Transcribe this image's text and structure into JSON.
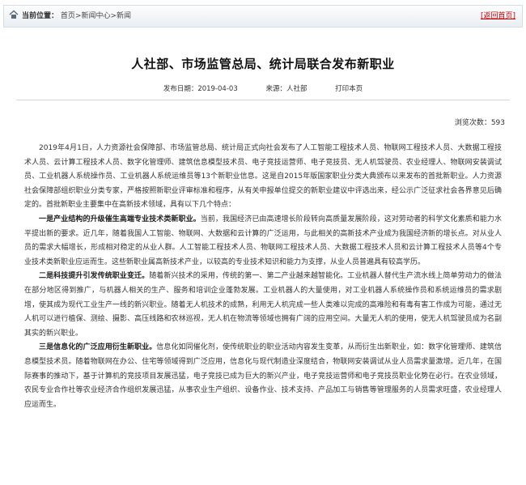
{
  "topbar": {
    "location_label": "当前位置：",
    "crumbs": [
      "首页",
      "新闻中心",
      "新闻"
    ],
    "separator": ">",
    "back_label": "[返回首页]"
  },
  "article": {
    "title": "人社部、市场监管总局、统计局联合发布新职业",
    "date": "发布日期：2019-04-03",
    "source": "来源：人社部",
    "print_label": "打印本页",
    "views": "浏览次数：593",
    "p1": "2019年4月1日，人力资源社会保障部、市场监管总局、统计局正式向社会发布了人工智能工程技术人员、物联网工程技术人员、大数据工程技术人员、云计算工程技术人员、数字化管理师、建筑信息模型技术员、电子竞技运营师、电子竞技员、无人机驾驶员、农业经理人、物联网安装调试员、工业机器人系统操作员、工业机器人系统运维员等13个新职业信息。这是自2015年版国家职业分类大典颁布以来发布的首批新职业。人力资源社会保障部组织职业分类专家，严格按照新职业评审标准和程序，从有关申报单位提交的新职业建议中评选出来，经公示广泛征求社会各界意见后确定的。首批新职业主要集中在高新技术领域，具有以下几个特点：",
    "p2_bold": "一是产业结构的升级催生高端专业技术类新职业。",
    "p2": "当前，我国经济已由高速增长阶段转向高质量发展阶段，这对劳动者的科学文化素质和能力水平提出新的要求。近几年，随着我国人工智能、物联网、大数据和云计算的广泛运用，与此相关的高新技术产业成为我国经济新的增长点。对从业人员的需求大幅增长，形成相对稳定的从业人群。人工智能工程技术人员、物联网工程技术人员、大数据工程技术人员和云计算工程技术人员等4个专业技术类新职业应运而生。这些新职业属高新技术产业，以较高的专业技术知识和能力为支撑，从业人员普遍具有较高学历。",
    "p3_bold": "二是科技提升引发传统职业变迁。",
    "p3": "随着新兴技术的采用，传统的第一、第二产业越来越智能化。工业机器人替代生产流水线上简单劳动力的做法在部分地区得到推广，与机器人相关的生产、服务和培训企业蓬勃发展。工业机器人的大量使用，对工业机器人系统操作员和系统运维员的需求剧增，使其成为现代工业生产一线的新兴职业。随着无人机技术的成熟，利用无人机完成一些人类难以完成的高难险和有毒有害工作成为可能，通过无人机可以进行植保、测绘、摄影、高压线路和农林巡视，无人机在物流等领域也拥有广阔的应用空间。大量无人机的使用，使无人机驾驶员成为名副其实的新兴职业。",
    "p4_bold": "三是信息化的广泛应用衍生新职业。",
    "p4": "信息化如同催化剂，使传统职业的职业活动内容发生变革，从而衍生出新职业，如：数字化管理师、建筑信息模型技术员。随着物联网在办公、住宅等领域得到广泛应用，信息化与现代制造业深度结合，物联网安装调试从业人员需求量激增。近几年，在国际赛事的推动下，基于计算机的竞技项目发展迅猛，电子竞技已成为巨大的新兴产业，电子竞技运营师和电子竞技员职业化势在必行。在农业领域，农民专业合作社等农业经济合作组织发展迅猛，从事农业生产组织、设备作业、技术支持、产品加工与销售等管理服务的人员需求旺盛，农业经理人应运而生。"
  }
}
